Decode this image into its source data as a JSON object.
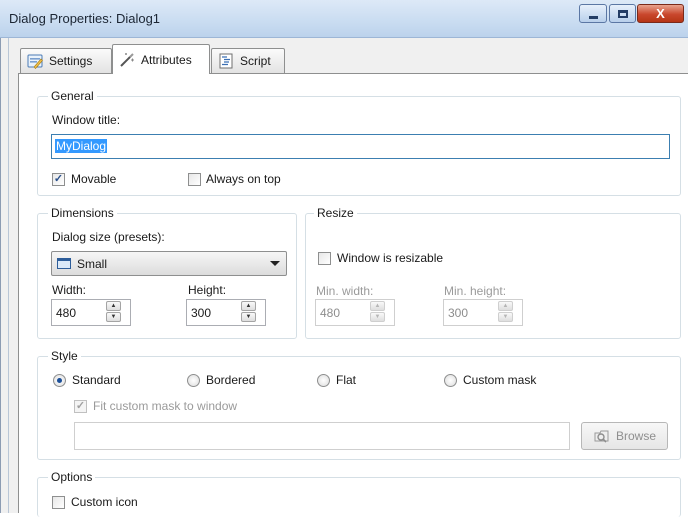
{
  "window": {
    "title": "Dialog Properties: Dialog1",
    "close_label": "X"
  },
  "tabs": [
    {
      "label": "Settings",
      "icon": "settings-icon"
    },
    {
      "label": "Attributes",
      "icon": "wand-icon",
      "active": true
    },
    {
      "label": "Script",
      "icon": "script-icon"
    }
  ],
  "general": {
    "title": "General",
    "window_title_label": "Window title:",
    "window_title_value": "MyDialog",
    "movable_label": "Movable",
    "movable_checked": true,
    "always_on_top_label": "Always on top",
    "always_on_top_checked": false
  },
  "dimensions": {
    "title": "Dimensions",
    "preset_label": "Dialog size (presets):",
    "preset_value": "Small",
    "width_label": "Width:",
    "width_value": "480",
    "height_label": "Height:",
    "height_value": "300"
  },
  "resize": {
    "title": "Resize",
    "resizable_label": "Window is resizable",
    "resizable_checked": false,
    "min_width_label": "Min. width:",
    "min_width_value": "480",
    "min_height_label": "Min. height:",
    "min_height_value": "300"
  },
  "style": {
    "title": "Style",
    "options": [
      {
        "label": "Standard",
        "selected": true
      },
      {
        "label": "Bordered",
        "selected": false
      },
      {
        "label": "Flat",
        "selected": false
      },
      {
        "label": "Custom mask",
        "selected": false
      }
    ],
    "fit_mask_label": "Fit custom mask to window",
    "fit_mask_checked": true,
    "mask_path_value": "",
    "browse_label": "Browse"
  },
  "options": {
    "title": "Options",
    "custom_icon_label": "Custom icon",
    "custom_icon_checked": false
  },
  "colors": {
    "accent": "#3399ff",
    "radio_dot": "#1c4f98",
    "close_button": "#c9472d"
  }
}
